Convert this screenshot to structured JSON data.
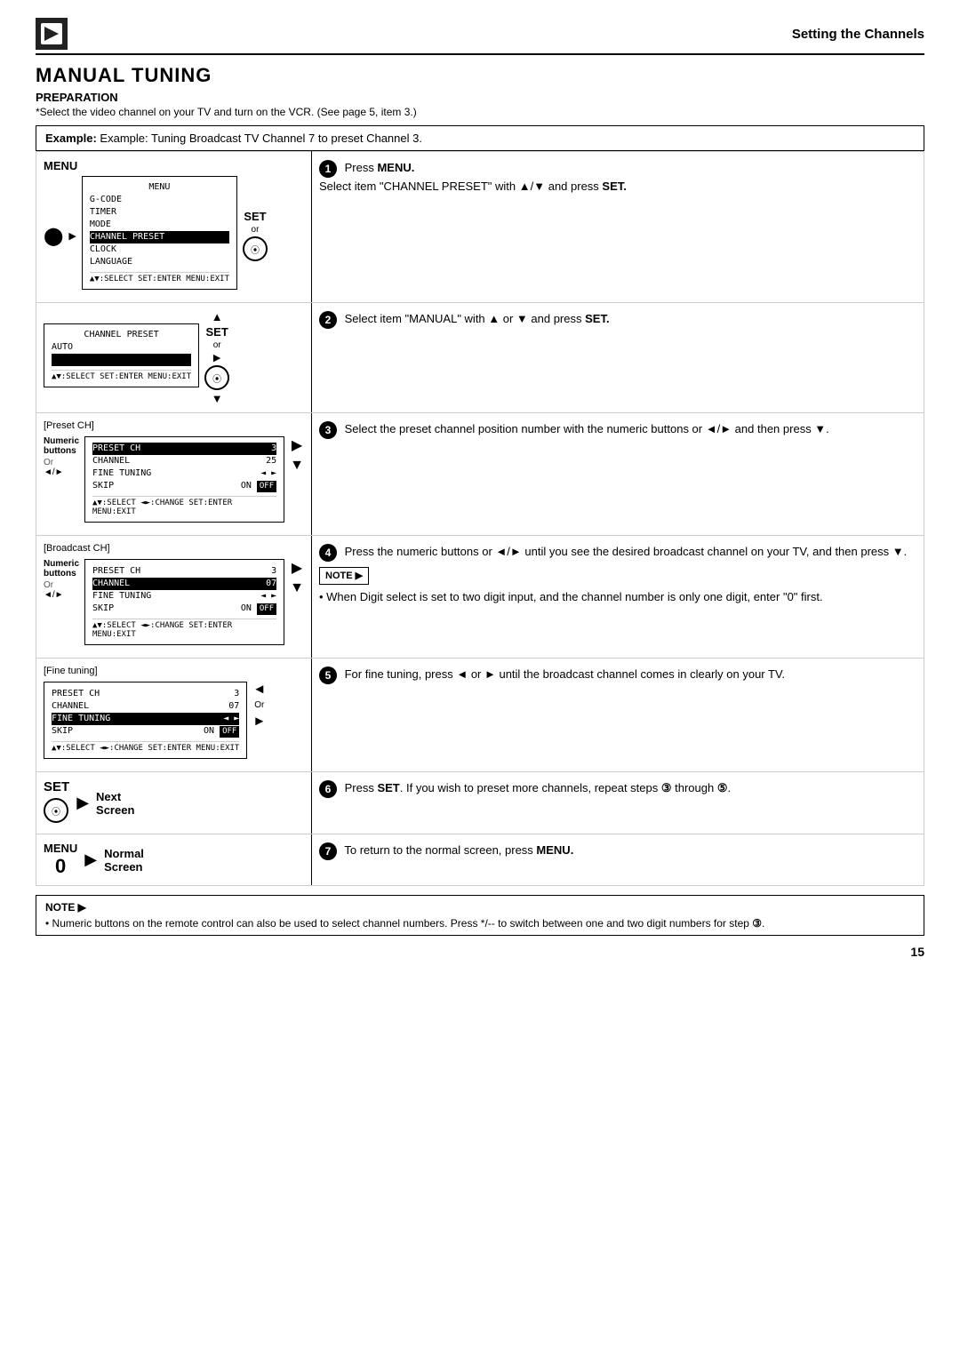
{
  "header": {
    "title": "Setting the Channels"
  },
  "section": {
    "title": "MANUAL TUNING",
    "preparation_label": "PREPARATION",
    "preparation_note": "*Select the video channel on your TV and turn on the VCR. (See page 5, item 3.)",
    "example": "Example: Tuning Broadcast TV Channel 7 to preset Channel 3."
  },
  "steps": [
    {
      "num": "1",
      "text_parts": [
        {
          "text": "Press ",
          "bold": false
        },
        {
          "text": "MENU.",
          "bold": true
        },
        {
          "text": "\nSelect item \"CHANNEL PRESET\" with ▲/▼ and press ",
          "bold": false
        },
        {
          "text": "SET.",
          "bold": true
        }
      ]
    },
    {
      "num": "2",
      "text_parts": [
        {
          "text": "Select item \"MANUAL\" with ▲ or ▼ and press ",
          "bold": false
        },
        {
          "text": "SET.",
          "bold": true
        }
      ]
    },
    {
      "num": "3",
      "text_parts": [
        {
          "text": "Select the preset channel position number with the numeric buttons or ◄/► and then press ▼.",
          "bold": false
        }
      ]
    },
    {
      "num": "4",
      "text_parts": [
        {
          "text": "Press the numeric buttons or ◄/► until you see the desired broadcast channel on your TV, and then press ▼.",
          "bold": false
        },
        {
          "text": "\nNOTE",
          "bold": false,
          "note": true
        },
        {
          "text": "\n• When Digit select is set to two digit input, and the channel number is only one digit, enter \"0\" first.",
          "bold": false
        }
      ]
    },
    {
      "num": "5",
      "text_parts": [
        {
          "text": "For fine tuning, press ◄ or ► until the broadcast channel comes in clearly on your TV.",
          "bold": false
        }
      ]
    },
    {
      "num": "6",
      "text_parts": [
        {
          "text": "Press ",
          "bold": false
        },
        {
          "text": "SET",
          "bold": true
        },
        {
          "text": ". If you wish to preset more channels, repeat steps ",
          "bold": false
        },
        {
          "text": "③",
          "bold": false
        },
        {
          "text": " through ",
          "bold": false
        },
        {
          "text": "⑤",
          "bold": false
        },
        {
          "text": ".",
          "bold": false
        }
      ]
    },
    {
      "num": "7",
      "text_parts": [
        {
          "text": "To return to the normal screen, press ",
          "bold": false
        },
        {
          "text": "MENU.",
          "bold": true
        }
      ]
    }
  ],
  "screens": {
    "screen1": {
      "title": "MENU",
      "rows": [
        {
          "label": "G-CODE",
          "value": "",
          "highlight": false
        },
        {
          "label": "TIMER",
          "value": "",
          "highlight": false
        },
        {
          "label": "MODE",
          "value": "",
          "highlight": false
        },
        {
          "label": "CHANNEL PRESET",
          "value": "",
          "highlight": true
        },
        {
          "label": "CLOCK",
          "value": "",
          "highlight": false
        },
        {
          "label": "LANGUAGE",
          "value": "",
          "highlight": false
        }
      ],
      "footer": "▲ ▼:SELECT    SET:ENTER    MENU:EXIT"
    },
    "screen2": {
      "title": "CHANNEL PRESET",
      "rows": [
        {
          "label": "AUTO",
          "value": "",
          "highlight": false
        }
      ],
      "footer": "▲ ▼:SELECT    SET:ENTER    MENU:EXIT"
    },
    "screen3": {
      "bracket": "[Preset CH]",
      "rows": [
        {
          "label": "PRESET CH",
          "value": "3",
          "highlight": true
        },
        {
          "label": "CHANNEL",
          "value": "25",
          "highlight": false
        },
        {
          "label": "FINE TUNING",
          "value": "◄ ►",
          "highlight": false
        },
        {
          "label": "SKIP",
          "value": "ON  OFF",
          "highlight": false
        }
      ],
      "footer": "▲ ▼:SELECT   ◄ ►:CHANGE    SET:ENTER    MENU:EXIT"
    },
    "screen4": {
      "bracket": "[Broadcast CH]",
      "rows": [
        {
          "label": "PRESET CH",
          "value": "3",
          "highlight": false
        },
        {
          "label": "CHANNEL",
          "value": "07",
          "highlight": true
        },
        {
          "label": "FINE TUNING",
          "value": "◄ ►",
          "highlight": false
        },
        {
          "label": "SKIP",
          "value": "ON  OFF",
          "highlight": false
        }
      ],
      "footer": "▲ ▼:SELECT   ◄ ►:CHANGE    SET:ENTER    MENU:EXIT"
    },
    "screen5": {
      "bracket": "[Fine tuning]",
      "rows": [
        {
          "label": "PRESET CH",
          "value": "3",
          "highlight": false
        },
        {
          "label": "CHANNEL",
          "value": "07",
          "highlight": false
        },
        {
          "label": "FINE TUNING",
          "value": "◄ ►",
          "highlight": true
        },
        {
          "label": "SKIP",
          "value": "ON  OFF",
          "highlight": false
        }
      ],
      "footer": "▲ ▼:SELECT   ◄ ►:CHANGE    SET:ENTER    MENU:EXIT"
    }
  },
  "labels": {
    "menu": "MENU",
    "set": "SET",
    "numeric_buttons": "Numeric\nbuttons",
    "or": "Or",
    "or2": "◄/►",
    "next_screen": "Next\nScreen",
    "normal_screen": "Normal\nScreen",
    "menu_zero": "MENU\n0"
  },
  "bottom_note": {
    "bullets": [
      "Numeric buttons on the remote control can also be used to select channel numbers. Press */-- to switch between one and two digit numbers for step ③."
    ]
  },
  "page_number": "15"
}
